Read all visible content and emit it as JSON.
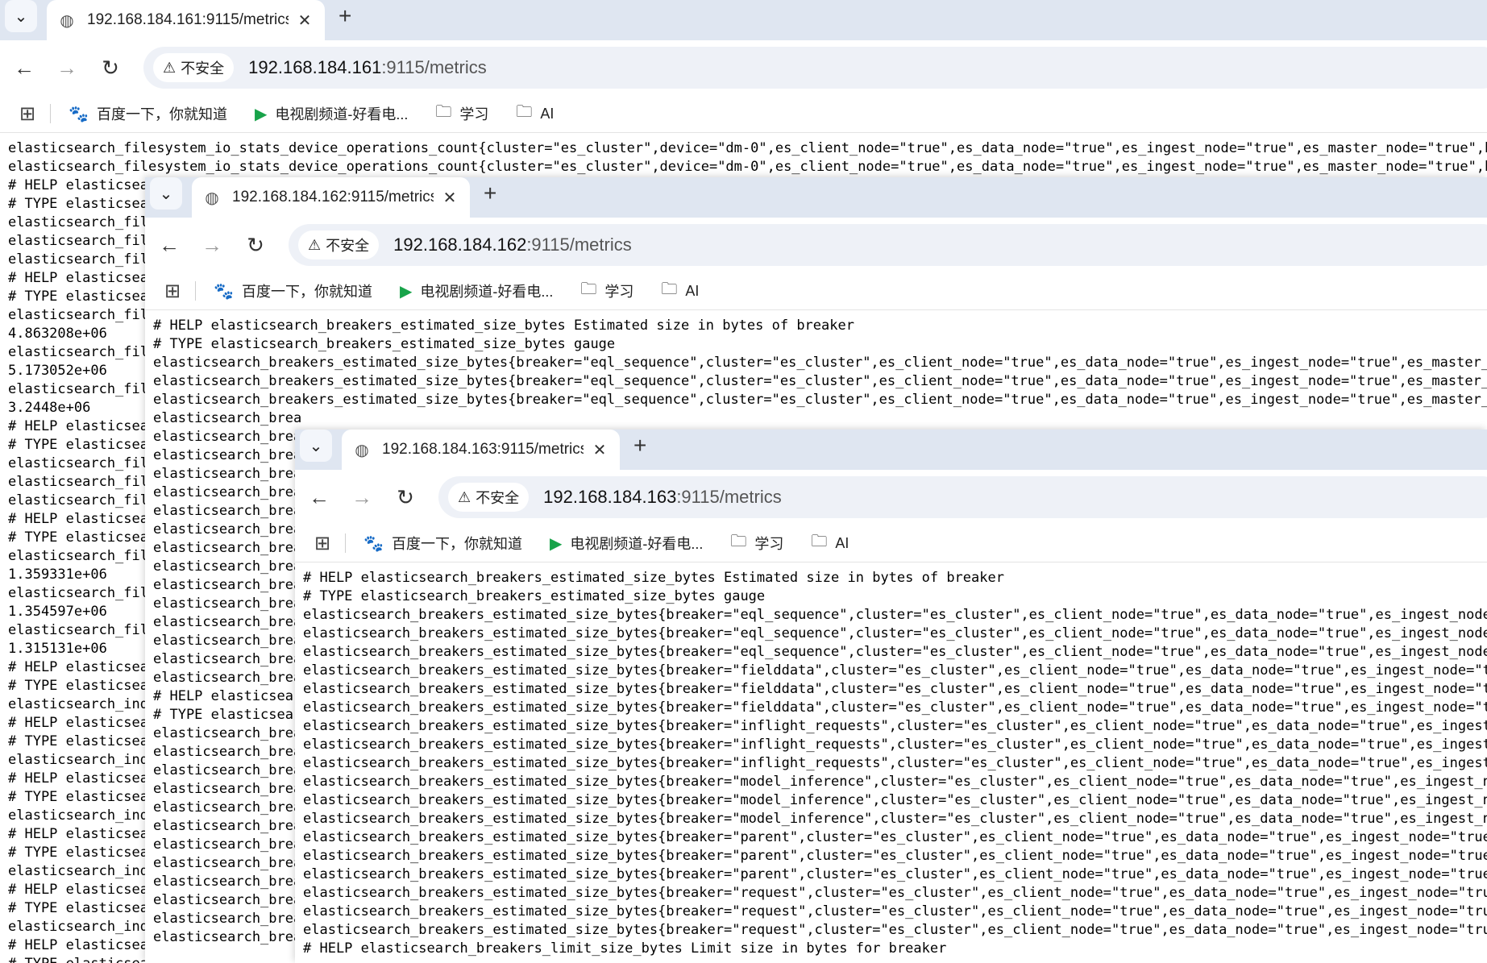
{
  "windows": [
    {
      "tab_title": "192.168.184.161:9115/metrics",
      "security_label": "不安全",
      "url_host": "192.168.184.161",
      "url_path": ":9115/metrics",
      "bookmarks": [
        "百度一下，你就知道",
        "电视剧频道-好看电...",
        "学习",
        "AI"
      ],
      "lines": [
        "elasticsearch_filesystem_io_stats_device_operations_count{cluster=\"es_cluster\",device=\"dm-0\",es_client_node=\"true\",es_data_node=\"true\",es_ingest_node=\"true\",es_master_node=\"true\",host=\"192.",
        "elasticsearch_filesystem_io_stats_device_operations_count{cluster=\"es_cluster\",device=\"dm-0\",es_client_node=\"true\",es_data_node=\"true\",es_ingest_node=\"true\",es_master_node=\"true\",host=\"192.",
        "# HELP elasticsearch",
        "# TYPE elasticsearch",
        "elasticsearch_file",
        "elasticsearch_file",
        "elasticsearch_file",
        "# HELP elasticsearch",
        "# TYPE elasticsearch",
        "elasticsearch_file",
        "4.863208e+06",
        "elasticsearch_file",
        "5.173052e+06",
        "elasticsearch_file",
        "3.2448e+06",
        "# HELP elasticsearch",
        "# TYPE elasticsearch",
        "elasticsearch_file",
        "elasticsearch_file",
        "elasticsearch_file",
        "# HELP elasticsearch",
        "# TYPE elasticsearch",
        "elasticsearch_file",
        "1.359331e+06",
        "elasticsearch_file",
        "1.354597e+06",
        "elasticsearch_file",
        "1.315131e+06",
        "# HELP elasticsearch",
        "# TYPE elasticsearch",
        "elasticsearch_indi",
        "# HELP elasticsearch",
        "# TYPE elasticsearch",
        "elasticsearch_indi",
        "# HELP elasticsearch",
        "# TYPE elasticsearch",
        "elasticsearch_indi",
        "# HELP elasticsearch",
        "# TYPE elasticsearch",
        "elasticsearch_indi",
        "# HELP elasticsearch",
        "# TYPE elasticsearch",
        "elasticsearch_indi",
        "# HELP elasticsearch",
        "# TYPE elasticsearch"
      ]
    },
    {
      "tab_title": "192.168.184.162:9115/metrics",
      "security_label": "不安全",
      "url_host": "192.168.184.162",
      "url_path": ":9115/metrics",
      "bookmarks": [
        "百度一下，你就知道",
        "电视剧频道-好看电...",
        "学习",
        "AI"
      ],
      "lines": [
        "# HELP elasticsearch_breakers_estimated_size_bytes Estimated size in bytes of breaker",
        "# TYPE elasticsearch_breakers_estimated_size_bytes gauge",
        "elasticsearch_breakers_estimated_size_bytes{breaker=\"eql_sequence\",cluster=\"es_cluster\",es_client_node=\"true\",es_data_node=\"true\",es_ingest_node=\"true\",es_master_node=\"tr",
        "elasticsearch_breakers_estimated_size_bytes{breaker=\"eql_sequence\",cluster=\"es_cluster\",es_client_node=\"true\",es_data_node=\"true\",es_ingest_node=\"true\",es_master_node=\"tr",
        "elasticsearch_breakers_estimated_size_bytes{breaker=\"eql_sequence\",cluster=\"es_cluster\",es_client_node=\"true\",es_data_node=\"true\",es_ingest_node=\"true\",es_master_node=\"tr",
        "elasticsearch_brea",
        "elasticsearch_brea",
        "elasticsearch_brea",
        "elasticsearch_brea",
        "elasticsearch_brea",
        "elasticsearch_brea",
        "elasticsearch_brea",
        "elasticsearch_brea",
        "elasticsearch_brea",
        "elasticsearch_brea",
        "elasticsearch_brea",
        "elasticsearch_brea",
        "elasticsearch_brea",
        "elasticsearch_brea",
        "elasticsearch_brea",
        "# HELP elasticsear",
        "# TYPE elasticsear",
        "elasticsearch_brea",
        "elasticsearch_brea",
        "elasticsearch_brea",
        "elasticsearch_brea",
        "elasticsearch_brea",
        "elasticsearch_brea",
        "elasticsearch_brea",
        "elasticsearch_brea",
        "elasticsearch_brea",
        "elasticsearch_brea",
        "elasticsearch_brea",
        "elasticsearch_brea"
      ]
    },
    {
      "tab_title": "192.168.184.163:9115/metrics",
      "security_label": "不安全",
      "url_host": "192.168.184.163",
      "url_path": ":9115/metrics",
      "bookmarks": [
        "百度一下，你就知道",
        "电视剧频道-好看电...",
        "学习",
        "AI"
      ],
      "lines": [
        "# HELP elasticsearch_breakers_estimated_size_bytes Estimated size in bytes of breaker",
        "# TYPE elasticsearch_breakers_estimated_size_bytes gauge",
        "elasticsearch_breakers_estimated_size_bytes{breaker=\"eql_sequence\",cluster=\"es_cluster\",es_client_node=\"true\",es_data_node=\"true\",es_ingest_node=\"true\"",
        "elasticsearch_breakers_estimated_size_bytes{breaker=\"eql_sequence\",cluster=\"es_cluster\",es_client_node=\"true\",es_data_node=\"true\",es_ingest_node=\"true\"",
        "elasticsearch_breakers_estimated_size_bytes{breaker=\"eql_sequence\",cluster=\"es_cluster\",es_client_node=\"true\",es_data_node=\"true\",es_ingest_node=\"true\"",
        "elasticsearch_breakers_estimated_size_bytes{breaker=\"fielddata\",cluster=\"es_cluster\",es_client_node=\"true\",es_data_node=\"true\",es_ingest_node=\"true\",e",
        "elasticsearch_breakers_estimated_size_bytes{breaker=\"fielddata\",cluster=\"es_cluster\",es_client_node=\"true\",es_data_node=\"true\",es_ingest_node=\"true\",e",
        "elasticsearch_breakers_estimated_size_bytes{breaker=\"fielddata\",cluster=\"es_cluster\",es_client_node=\"true\",es_data_node=\"true\",es_ingest_node=\"true\",e",
        "elasticsearch_breakers_estimated_size_bytes{breaker=\"inflight_requests\",cluster=\"es_cluster\",es_client_node=\"true\",es_data_node=\"true\",es_ingest_node=\"",
        "elasticsearch_breakers_estimated_size_bytes{breaker=\"inflight_requests\",cluster=\"es_cluster\",es_client_node=\"true\",es_data_node=\"true\",es_ingest_node=\"",
        "elasticsearch_breakers_estimated_size_bytes{breaker=\"inflight_requests\",cluster=\"es_cluster\",es_client_node=\"true\",es_data_node=\"true\",es_ingest_node=\"",
        "elasticsearch_breakers_estimated_size_bytes{breaker=\"model_inference\",cluster=\"es_cluster\",es_client_node=\"true\",es_data_node=\"true\",es_ingest_node=\"tr",
        "elasticsearch_breakers_estimated_size_bytes{breaker=\"model_inference\",cluster=\"es_cluster\",es_client_node=\"true\",es_data_node=\"true\",es_ingest_node=\"tr",
        "elasticsearch_breakers_estimated_size_bytes{breaker=\"model_inference\",cluster=\"es_cluster\",es_client_node=\"true\",es_data_node=\"true\",es_ingest_node=\"tr",
        "elasticsearch_breakers_estimated_size_bytes{breaker=\"parent\",cluster=\"es_cluster\",es_client_node=\"true\",es_data_node=\"true\",es_ingest_node=\"true\",es_ma",
        "elasticsearch_breakers_estimated_size_bytes{breaker=\"parent\",cluster=\"es_cluster\",es_client_node=\"true\",es_data_node=\"true\",es_ingest_node=\"true\",es_ma",
        "elasticsearch_breakers_estimated_size_bytes{breaker=\"parent\",cluster=\"es_cluster\",es_client_node=\"true\",es_data_node=\"true\",es_ingest_node=\"true\",es_ma",
        "elasticsearch_breakers_estimated_size_bytes{breaker=\"request\",cluster=\"es_cluster\",es_client_node=\"true\",es_data_node=\"true\",es_ingest_node=\"true\",es_m",
        "elasticsearch_breakers_estimated_size_bytes{breaker=\"request\",cluster=\"es_cluster\",es_client_node=\"true\",es_data_node=\"true\",es_ingest_node=\"true\",es_m",
        "elasticsearch_breakers_estimated_size_bytes{breaker=\"request\",cluster=\"es_cluster\",es_client_node=\"true\",es_data_node=\"true\",es_ingest_node=\"true\",es_m",
        "# HELP elasticsearch_breakers_limit_size_bytes Limit size in bytes for breaker"
      ]
    }
  ]
}
